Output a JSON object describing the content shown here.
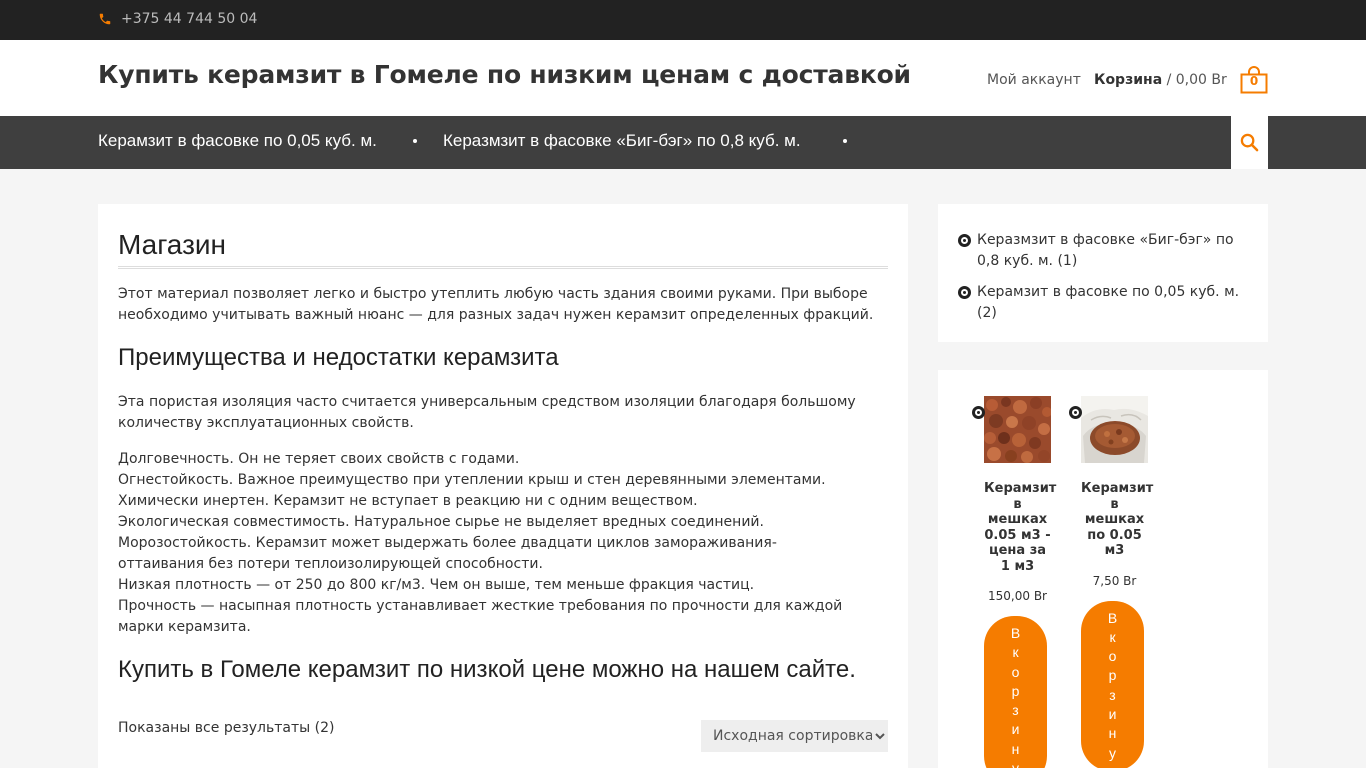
{
  "topbar": {
    "phone": "+375 44 744 50 04",
    "phone_icon": "phone-icon"
  },
  "header": {
    "site_title": "Купить керамзит в Гомеле по низким ценам с доставкой",
    "account_label": "Мой аккаунт",
    "cart_label": "Корзина",
    "cart_total": " / 0,00 Br",
    "cart_count": "0",
    "cart_icon": "cart-icon"
  },
  "nav": {
    "items": [
      {
        "label": "Керамзит в фасовке по 0,05 куб. м."
      },
      {
        "label": "Керазмзит в фасовке «Биг-бэг» по 0,8 куб. м."
      }
    ],
    "search_icon": "search-icon"
  },
  "main": {
    "title": "Магазин",
    "intro": "Этот материал позволяет легко и быстро утеплить любую часть здания своими руками. При выборе необходимо учитывать важный нюанс — для разных задач нужен керамзит определенных фракций.",
    "h2_pros": "Преимущества и недостатки керамзита",
    "para_porous": "Эта пористая изоляция часто считается универсальным средством изоляции благодаря большому количеству эксплуатационных свойств.",
    "props": [
      "Долговечность. Он не теряет своих свойств с годами.",
      "Огнестойкость. Важное преимущество при утеплении крыш и стен деревянными элементами.",
      "Химически инертен. Керамзит не вступает в реакцию ни с одним веществом.",
      "Экологическая совместимость. Натуральное сырье не выделяет вредных соединений.",
      "Морозостойкость. Керамзит может выдержать более двадцати циклов замораживания-оттаивания без потери теплоизолирующей способности.",
      "Низкая плотность — от 250 до 800 кг/м3. Чем он выше, тем меньше фракция частиц.",
      "Прочность — насыпная плотность устанавливает жесткие требования по прочности для каждой марки керамзита."
    ],
    "h2_buy": "Купить в Гомеле керамзит по низкой цене можно на нашем сайте.",
    "result_count": "Показаны все результаты (2)",
    "sort_selected": "Исходная сортировка"
  },
  "sidebar": {
    "categories": [
      {
        "label": "Керазмзит в фасовке «Биг-бэг» по 0,8 куб. м. (1)"
      },
      {
        "label": "Керамзит в фасовке по 0,05 куб. м. (2)"
      }
    ],
    "products": [
      {
        "name": "Керамзит в мешках 0.05 м3 - цена за 1 м3",
        "price": "150,00 Br",
        "button": "В корзину"
      },
      {
        "name": "Керамзит в мешках по 0.05 м3",
        "price": "7,50 Br",
        "button": "В корзину"
      }
    ]
  },
  "colors": {
    "accent": "#f57c00",
    "topbar": "#222222",
    "nav": "#3f3f3f",
    "background": "#f5f5f5"
  }
}
